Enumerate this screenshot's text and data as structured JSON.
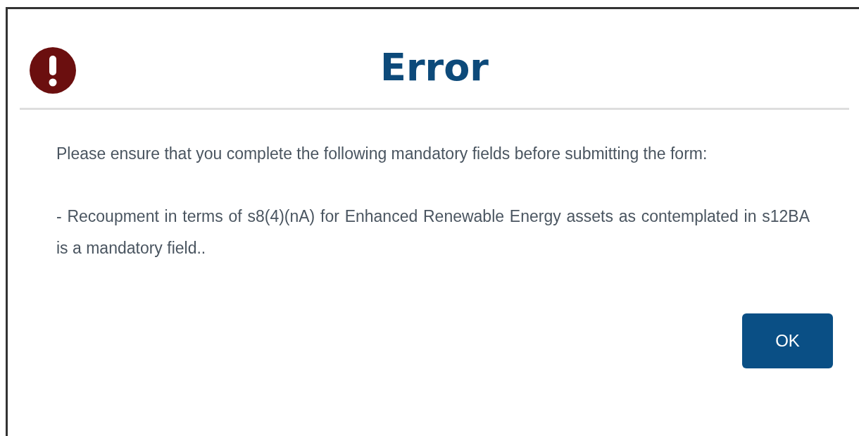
{
  "dialog": {
    "title": "Error",
    "paragraphs": [
      "Please ensure that you complete the following mandatory fields before submitting the form:",
      "- Recoupment in terms of s8(4)(nA) for Enhanced Renewable Energy assets as contemplated in s12BA is a mandatory field.."
    ],
    "buttons": [
      "OK"
    ]
  }
}
